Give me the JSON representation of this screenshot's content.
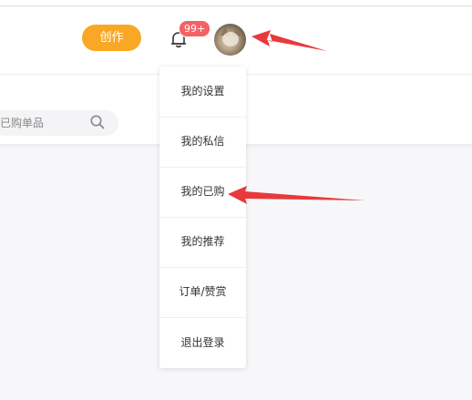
{
  "header": {
    "create_label": "创作",
    "notification_badge": "99+",
    "avatar_alt": "user avatar"
  },
  "search": {
    "placeholder_text": "已购单品"
  },
  "dropdown": {
    "items": [
      {
        "label": "我的设置"
      },
      {
        "label": "我的私信"
      },
      {
        "label": "我的已购"
      },
      {
        "label": "我的推荐"
      },
      {
        "label": "订单/赞赏"
      },
      {
        "label": "退出登录"
      }
    ]
  },
  "colors": {
    "accent": "#f9a825",
    "badge": "#f36265",
    "annotation_arrow": "#e8393c"
  },
  "icons": {
    "bell": "bell-icon",
    "search": "search-icon",
    "avatar": "cat-avatar"
  }
}
